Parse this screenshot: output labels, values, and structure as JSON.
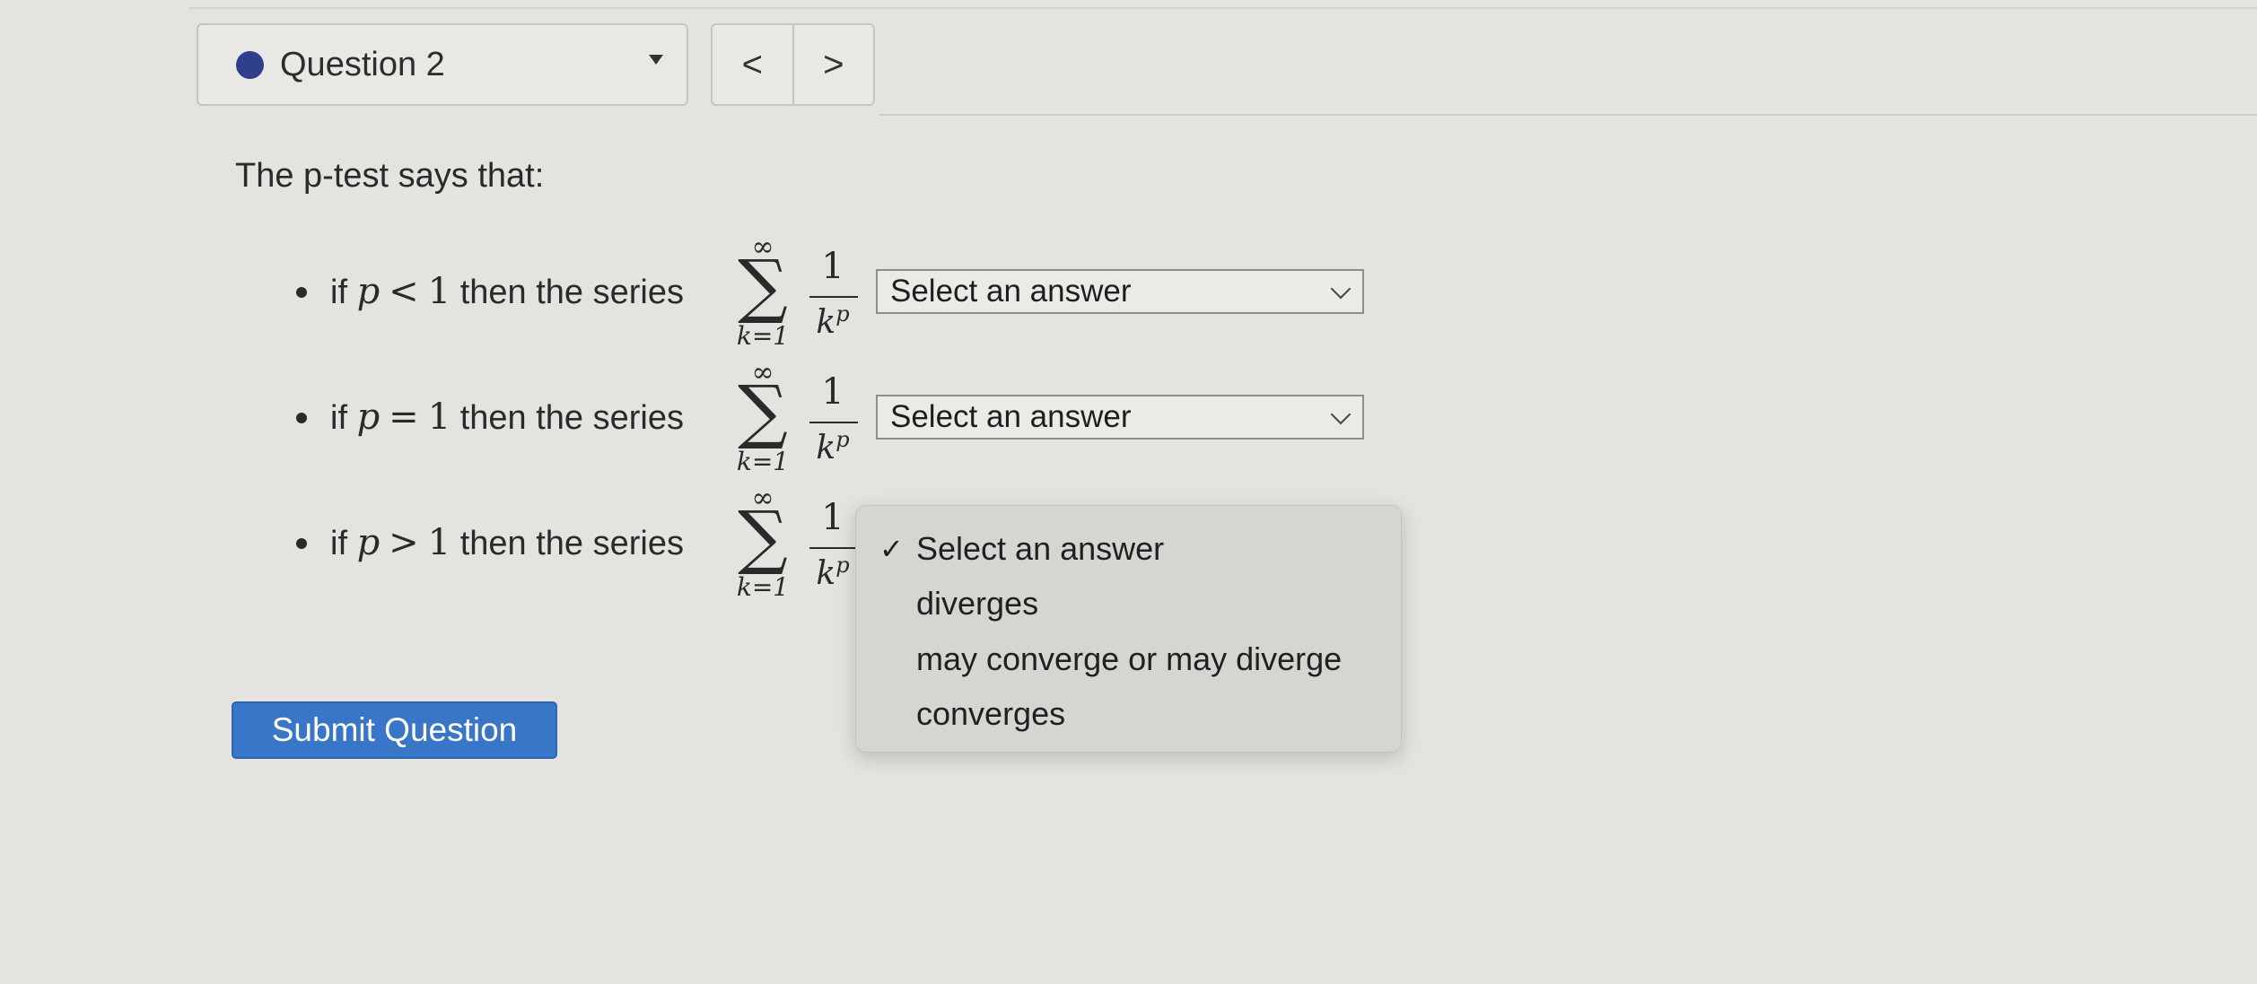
{
  "header": {
    "question_label": "Question 2",
    "status_color": "#2f3f8a",
    "caret_icon": "dropdown-caret-icon",
    "prev_label": "<",
    "next_label": ">"
  },
  "question": {
    "intro": "The p-test says that:",
    "items": [
      {
        "prefix": "if",
        "variable": "p",
        "relation": "<",
        "value": "1",
        "suffix": "then the series",
        "sum_upper": "∞",
        "sum_symbol": "∑",
        "sum_lower": "k=1",
        "numerator": "1",
        "denominator_base": "k",
        "denominator_exp": "p",
        "selected": "Select an answer"
      },
      {
        "prefix": "if",
        "variable": "p",
        "relation": "=",
        "value": "1",
        "suffix": "then the series",
        "sum_upper": "∞",
        "sum_symbol": "∑",
        "sum_lower": "k=1",
        "numerator": "1",
        "denominator_base": "k",
        "denominator_exp": "p",
        "selected": "Select an answer"
      },
      {
        "prefix": "if",
        "variable": "p",
        "relation": ">",
        "value": "1",
        "suffix": "then the series",
        "sum_upper": "∞",
        "sum_symbol": "∑",
        "sum_lower": "k=1",
        "numerator": "1",
        "denominator_base": "k",
        "denominator_exp": "p"
      }
    ]
  },
  "dropdown": {
    "options": [
      {
        "label": "Select an answer",
        "checked": true
      },
      {
        "label": "diverges",
        "checked": false
      },
      {
        "label": "may converge or may diverge",
        "checked": false
      },
      {
        "label": "converges",
        "checked": false
      }
    ],
    "check_mark": "✓"
  },
  "submit": {
    "label": "Submit Question",
    "color": "#3a76c8"
  }
}
